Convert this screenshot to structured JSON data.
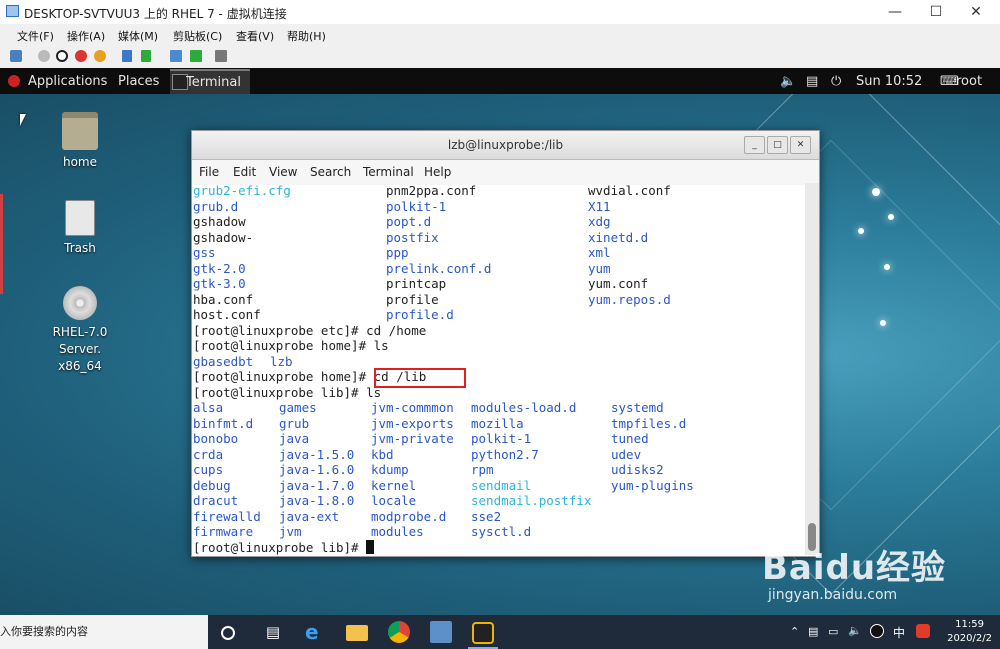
{
  "host": {
    "title": "DESKTOP-SVTVUU3 上的 RHEL 7 - 虚拟机连接",
    "menu": [
      "文件(F)",
      "操作(A)",
      "媒体(M)",
      "剪贴板(C)",
      "查看(V)",
      "帮助(H)"
    ]
  },
  "gnome": {
    "applications": "Applications",
    "places": "Places",
    "task": "Terminal",
    "clock": "Sun 10:52",
    "user": "root"
  },
  "desktop": {
    "icons": [
      {
        "label": "home"
      },
      {
        "label": "Trash"
      },
      {
        "label": "RHEL-7.0 Server.\nx86_64"
      }
    ]
  },
  "terminal": {
    "title": "lzb@linuxprobe:/lib",
    "menu": [
      "File",
      "Edit",
      "View",
      "Search",
      "Terminal",
      "Help"
    ],
    "top_listing": [
      [
        "grub2-efi.cfg",
        "pnm2ppa.conf",
        "wvdial.conf"
      ],
      [
        "grub.d",
        "polkit-1",
        "X11"
      ],
      [
        "gshadow",
        "popt.d",
        "xdg"
      ],
      [
        "gshadow-",
        "postfix",
        "xinetd.d"
      ],
      [
        "gss",
        "ppp",
        "xml"
      ],
      [
        "gtk-2.0",
        "prelink.conf.d",
        "yum"
      ],
      [
        "gtk-3.0",
        "printcap",
        "yum.conf"
      ],
      [
        "hba.conf",
        "profile",
        "yum.repos.d"
      ],
      [
        "host.conf",
        "profile.d",
        ""
      ]
    ],
    "cmd1": "[root@linuxprobe etc]# cd /home",
    "cmd2": "[root@linuxprobe home]# ls",
    "home_ls": [
      "gbasedbt",
      "lzb"
    ],
    "cmd3_prompt": "[root@linuxprobe home]#",
    "cmd3_arg": " cd /lib",
    "cmd4": "[root@linuxprobe lib]# ls",
    "lib_listing": [
      [
        "alsa",
        "games",
        "jvm-commmon",
        "modules-load.d",
        "systemd"
      ],
      [
        "binfmt.d",
        "grub",
        "jvm-exports",
        "mozilla",
        "tmpfiles.d"
      ],
      [
        "bonobo",
        "java",
        "jvm-private",
        "polkit-1",
        "tuned"
      ],
      [
        "crda",
        "java-1.5.0",
        "kbd",
        "python2.7",
        "udev"
      ],
      [
        "cups",
        "java-1.6.0",
        "kdump",
        "rpm",
        "udisks2"
      ],
      [
        "debug",
        "java-1.7.0",
        "kernel",
        "sendmail",
        "yum-plugins"
      ],
      [
        "dracut",
        "java-1.8.0",
        "locale",
        "sendmail.postfix",
        ""
      ],
      [
        "firewalld",
        "java-ext",
        "modprobe.d",
        "sse2",
        ""
      ],
      [
        "firmware",
        "jvm",
        "modules",
        "sysctl.d",
        ""
      ]
    ],
    "prompt_final": "[root@linuxprobe lib]# "
  },
  "taskbar": {
    "search_placeholder": "入你要搜索的内容",
    "time": "11:59",
    "date": "2020/2/2",
    "ime": "中"
  },
  "watermark": {
    "brand": "Baidu经验",
    "url": "jingyan.baidu.com"
  }
}
